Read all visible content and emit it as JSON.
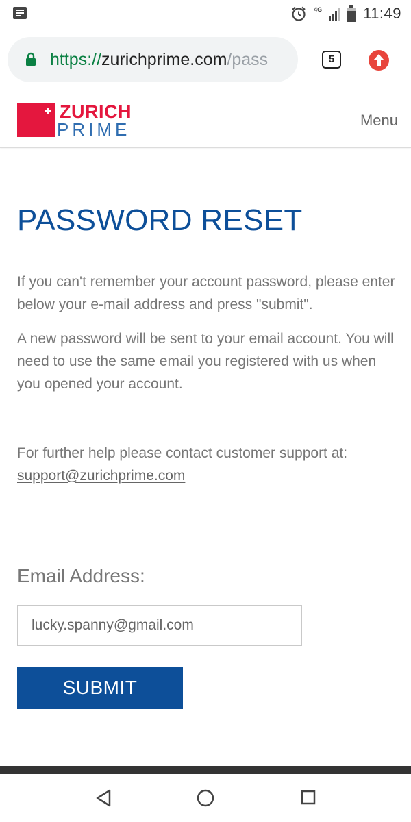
{
  "status_bar": {
    "time": "11:49",
    "network": "4G",
    "icons": [
      "notification-icon",
      "alarm-icon",
      "signal-icon",
      "battery-icon"
    ]
  },
  "browser": {
    "url_scheme": "https://",
    "url_host": "zurichprime.com",
    "url_path": "/pass",
    "tab_count": "5",
    "icons": [
      "lock-icon",
      "tab-switcher-icon",
      "update-icon"
    ]
  },
  "site_header": {
    "logo_line1": "ZURICH",
    "logo_line2": "PRIME",
    "menu_label": "Menu"
  },
  "page": {
    "title": "PASSWORD RESET",
    "paragraph1": "If you can't remember your account password, please enter below your e-mail address and press \"submit\".",
    "paragraph2": "A new password will be sent to your email account. You will need to use the same email you registered with us when you opened your account.",
    "help_text": "For further help please contact customer support at:",
    "support_email": "support@zurichprime.com"
  },
  "form": {
    "email_label": "Email Address:",
    "email_value": "lucky.spanny@gmail.com",
    "submit_label": "SUBMIT"
  },
  "colors": {
    "brand_blue": "#0d4f99",
    "brand_red": "#e4173e",
    "secure_green": "#0b8043"
  }
}
